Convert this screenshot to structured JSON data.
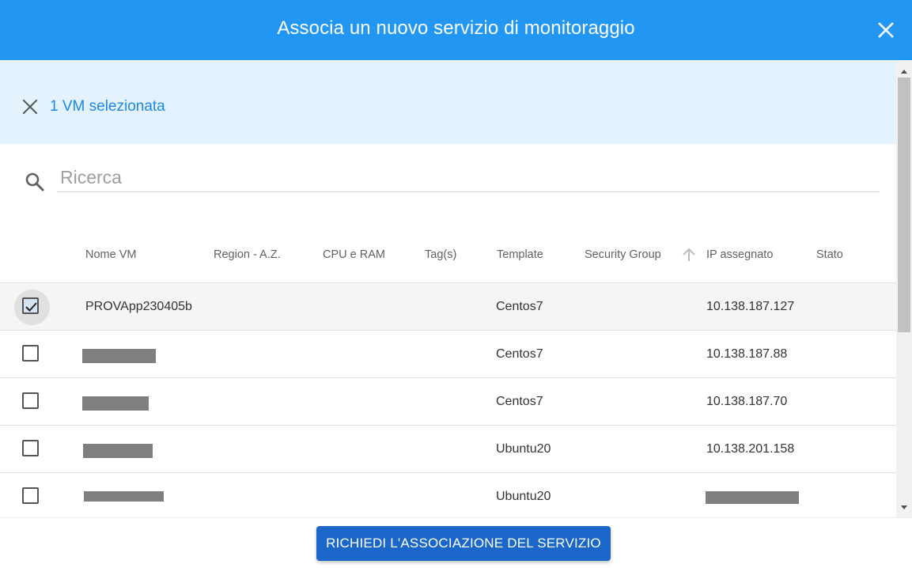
{
  "dialog": {
    "title": "Associa un nuovo servizio di monitoraggio",
    "close_icon": "close-icon"
  },
  "selection": {
    "label": "1 VM selezionata",
    "clear_icon": "close-icon"
  },
  "search": {
    "placeholder": "Ricerca",
    "value": ""
  },
  "table": {
    "columns": [
      "Nome VM",
      "Region - A.Z.",
      "CPU e RAM",
      "Tag(s)",
      "Template",
      "Security Group",
      "IP assegnato",
      "Stato"
    ],
    "sorted_column": "IP assegnato",
    "sort_direction": "ascending",
    "rows": [
      {
        "checked": true,
        "name": "PROVApp230405b",
        "name_redacted": false,
        "template": "Centos7",
        "ip": "10.138.187.127",
        "ip_redacted": false
      },
      {
        "checked": false,
        "name": "",
        "name_redacted": true,
        "template": "Centos7",
        "ip": "10.138.187.88",
        "ip_redacted": false
      },
      {
        "checked": false,
        "name": "",
        "name_redacted": true,
        "template": "Centos7",
        "ip": "10.138.187.70",
        "ip_redacted": false
      },
      {
        "checked": false,
        "name": "",
        "name_redacted": true,
        "template": "Ubuntu20",
        "ip": "10.138.201.158",
        "ip_redacted": false
      },
      {
        "checked": false,
        "name": "",
        "name_redacted": true,
        "template": "Ubuntu20",
        "ip": "",
        "ip_redacted": true
      }
    ]
  },
  "footer": {
    "submit_label": "RICHIEDI L'ASSOCIAZIONE DEL SERVIZIO"
  },
  "colors": {
    "header": "#2196f3",
    "selection_bar": "#e3f2fd",
    "selection_text": "#1e88e5",
    "button": "#1a66c9"
  }
}
